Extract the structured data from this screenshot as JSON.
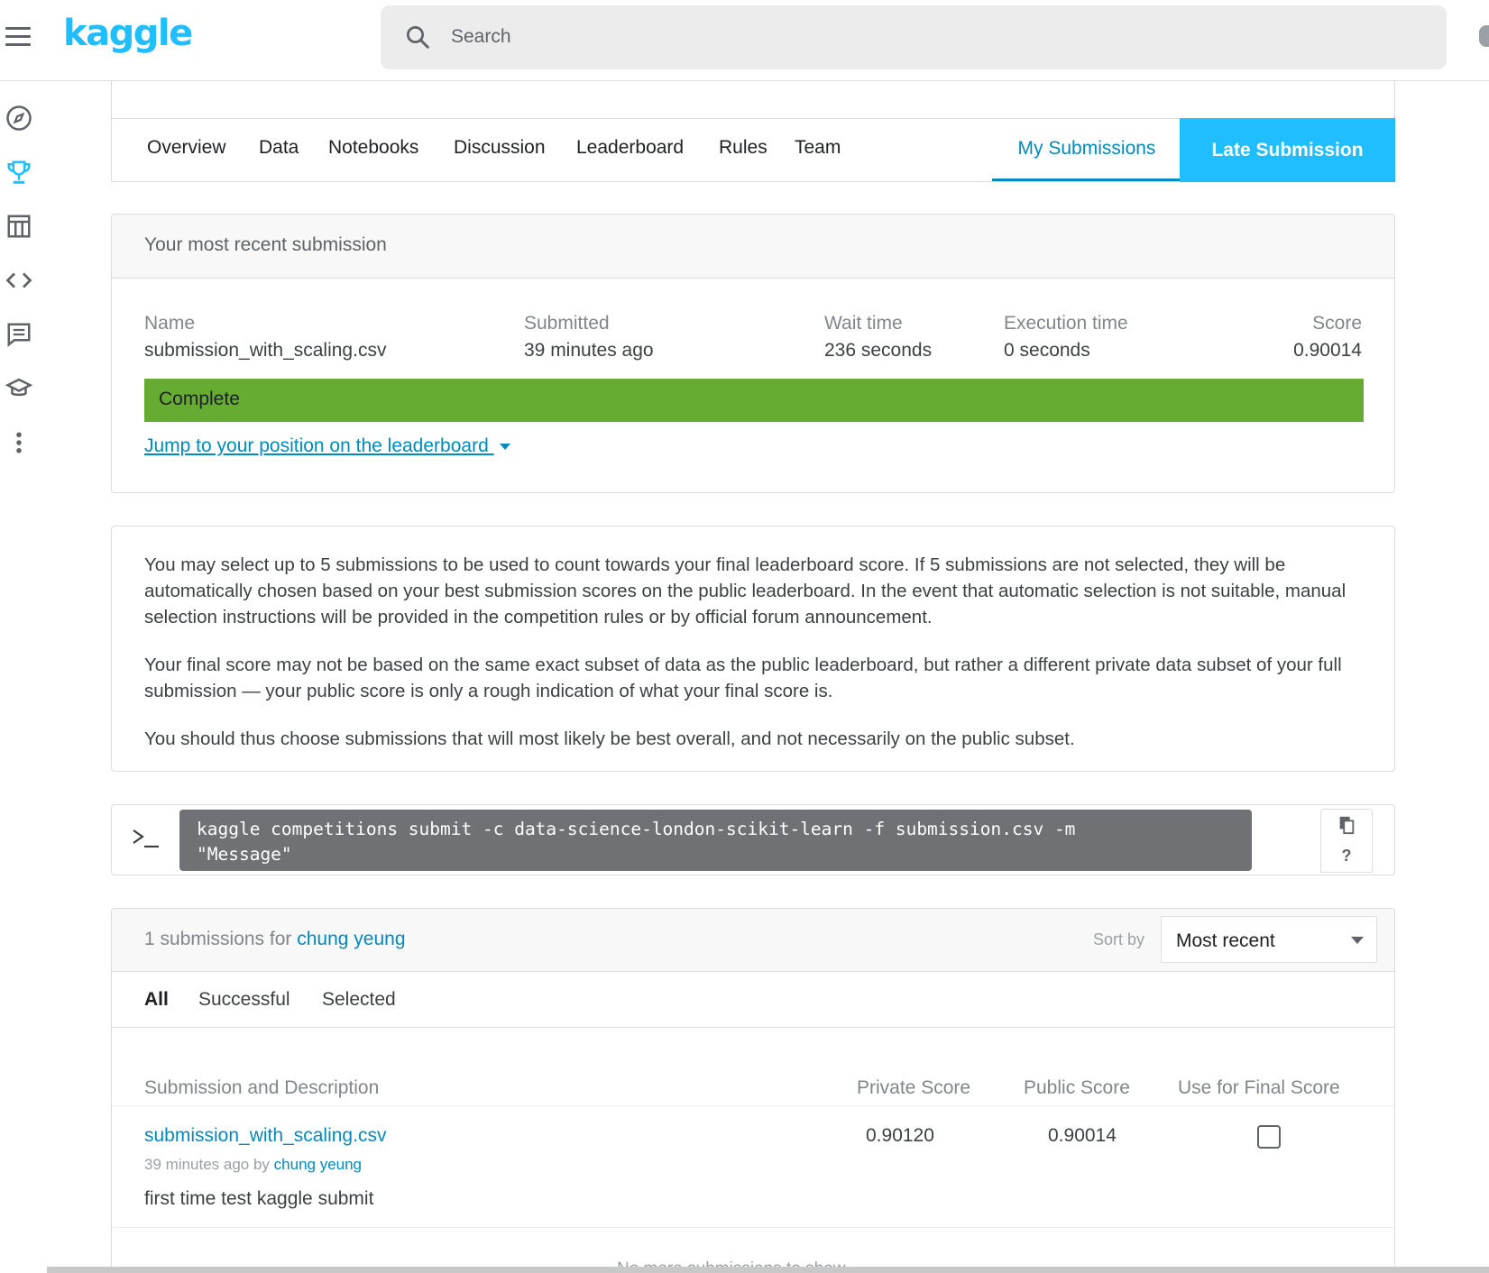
{
  "app": {
    "logo": "kaggle",
    "search_placeholder": "Search"
  },
  "rail": {
    "items": [
      {
        "icon": "compass-icon",
        "label": "Home"
      },
      {
        "icon": "trophy-icon",
        "label": "Competitions",
        "active": true
      },
      {
        "icon": "table-icon",
        "label": "Datasets"
      },
      {
        "icon": "code-icon",
        "label": "Code"
      },
      {
        "icon": "discussion-icon",
        "label": "Discussions"
      },
      {
        "icon": "graduation-cap-icon",
        "label": "Courses"
      },
      {
        "icon": "more-vertical-icon",
        "label": "More"
      }
    ]
  },
  "tabs": {
    "items": [
      "Overview",
      "Data",
      "Notebooks",
      "Discussion",
      "Leaderboard",
      "Rules",
      "Team"
    ],
    "my_submissions": "My Submissions",
    "late_submission": "Late Submission"
  },
  "recent": {
    "header": "Your most recent submission",
    "name_label": "Name",
    "name_value": "submission_with_scaling.csv",
    "submitted_label": "Submitted",
    "submitted_value": "39 minutes ago",
    "wait_label": "Wait time",
    "wait_value": "236 seconds",
    "exec_label": "Execution time",
    "exec_value": "0 seconds",
    "score_label": "Score",
    "score_value": "0.90014",
    "status": "Complete",
    "status_color": "#66ab32",
    "jump_link": "Jump to your position on the leaderboard "
  },
  "info": {
    "p1": "You may select up to 5 submissions to be used to count towards your final leaderboard score. If 5 submissions are not selected, they will be automatically chosen based on your best submission scores on the public leaderboard. In the event that automatic selection is not suitable, manual selection instructions will be provided in the competition rules or by official forum announcement.",
    "p2": "Your final score may not be based on the same exact subset of data as the public leaderboard, but rather a different private data subset of your full submission — your public score is only a rough indication of what your final score is.",
    "p3": "You should thus choose submissions that will most likely be best overall, and not necessarily on the public subset."
  },
  "cli": {
    "line1": "kaggle competitions submit -c data-science-london-scikit-learn -f submission.csv -m",
    "line2": "\"Message\"",
    "help": "?"
  },
  "submissions": {
    "count_text": "1 submissions for ",
    "user": "chung yeung",
    "sort_label": "Sort by",
    "sort_value": "Most recent",
    "filters": [
      "All",
      "Successful",
      "Selected"
    ],
    "columns": {
      "description": "Submission and Description",
      "private": "Private Score",
      "public": "Public Score",
      "final": "Use for Final Score"
    },
    "rows": [
      {
        "file": "submission_with_scaling.csv",
        "time": "39 minutes ago by ",
        "by": "chung yeung",
        "description": "first time test kaggle submit",
        "private_score": "0.90120",
        "public_score": "0.90014",
        "use_for_final": false
      }
    ],
    "footer": "No more submissions to show"
  },
  "colors": {
    "brand": "#20beff",
    "link": "#008abc",
    "complete": "#66ab32",
    "code_bg": "#707174"
  }
}
